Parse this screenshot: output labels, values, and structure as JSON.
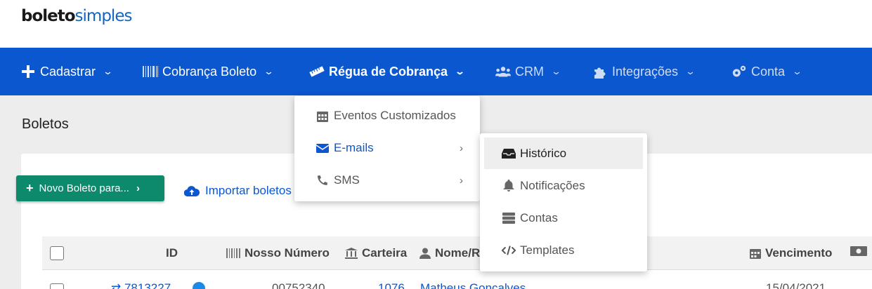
{
  "logo": {
    "bold": "boleto",
    "light": "simples"
  },
  "nav": {
    "items": [
      {
        "label": "Cadastrar",
        "icon": "plus-icon"
      },
      {
        "label": "Cobrança Boleto",
        "icon": "barcode-icon"
      },
      {
        "label": "Régua de Cobrança",
        "icon": "ruler-icon"
      },
      {
        "label": "CRM",
        "icon": "users-icon"
      },
      {
        "label": "Integrações",
        "icon": "puzzle-icon"
      },
      {
        "label": "Conta",
        "icon": "cogs-icon"
      }
    ]
  },
  "page_title": "Boletos",
  "toolbar": {
    "new_boleto": "Novo Boleto para...",
    "import": "Importar boletos"
  },
  "table": {
    "headers": {
      "id": "ID",
      "nosso_numero": "Nosso Número",
      "carteira": "Carteira",
      "nome": "Nome/R",
      "vencimento": "Vencimento"
    },
    "row": {
      "id": "7813227",
      "nosso_numero": "00752340",
      "carteira": "1076",
      "nome": "Matheus Gonçalves",
      "vencimento": "15/04/2021"
    }
  },
  "dropdown": {
    "items": [
      {
        "label": "Eventos Customizados",
        "icon": "calendar-icon"
      },
      {
        "label": "E-mails",
        "icon": "envelope-icon"
      },
      {
        "label": "SMS",
        "icon": "phone-icon"
      }
    ]
  },
  "submenu": {
    "items": [
      {
        "label": "Histórico",
        "icon": "inbox-icon"
      },
      {
        "label": "Notificações",
        "icon": "bell-icon"
      },
      {
        "label": "Contas",
        "icon": "server-icon"
      },
      {
        "label": "Templates",
        "icon": "code-icon"
      }
    ]
  },
  "colors": {
    "primary": "#0b57d0",
    "success": "#0d8a6c"
  }
}
